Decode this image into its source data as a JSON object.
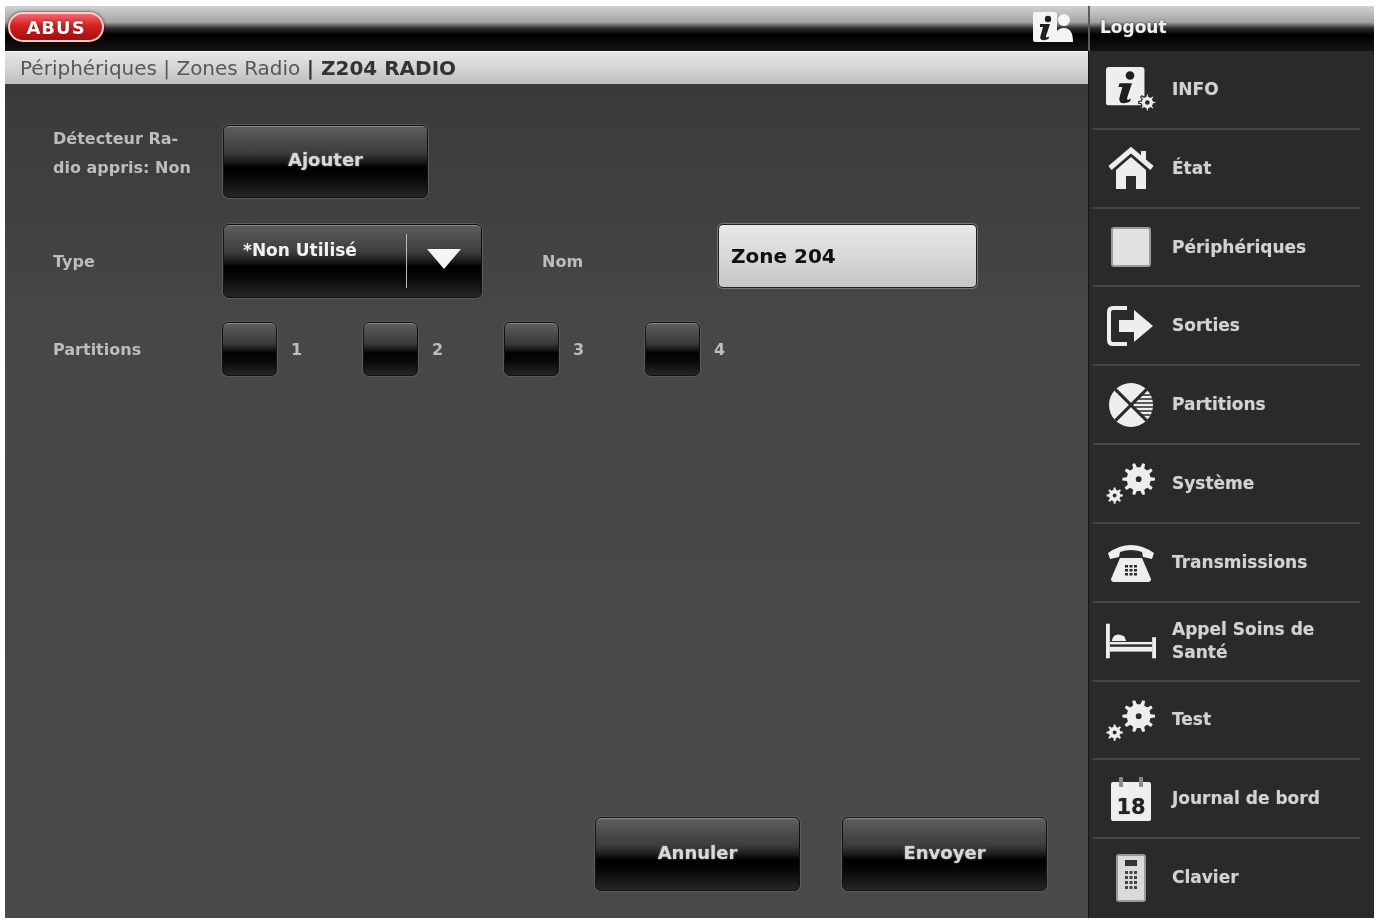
{
  "header": {
    "logo": "ABUS",
    "logout": "Logout"
  },
  "breadcrumb": "Périphériques | Zones Radio **| Z204 RADIO**",
  "form": {
    "learned_label_lines": [
      "Détecteur Ra-",
      "dio appris: Non"
    ],
    "add_button": "Ajouter",
    "type": {
      "label": "Type",
      "value": "*Non Utilisé"
    },
    "name": {
      "label": "Nom",
      "value": "Zone 204"
    },
    "partitions": {
      "label": "Partitions",
      "options": [
        {
          "label": "1",
          "checked": false
        },
        {
          "label": "2",
          "checked": false
        },
        {
          "label": "3",
          "checked": false
        },
        {
          "label": "4",
          "checked": false
        }
      ]
    }
  },
  "buttons": [
    "Annuler",
    "Envoyer"
  ],
  "sidebar": {
    "items": [
      {
        "label": "INFO"
      },
      {
        "label": "État"
      },
      {
        "label": "Périphériques"
      },
      {
        "label": "Sorties"
      },
      {
        "label": "Partitions"
      },
      {
        "label": "Système"
      },
      {
        "label": "Transmissions"
      },
      {
        "label": "Appel Soins de Santé"
      },
      {
        "label": "Test"
      },
      {
        "label": "Journal de bord",
        "icon_text": "18"
      },
      {
        "label": "Clavier"
      }
    ]
  }
}
